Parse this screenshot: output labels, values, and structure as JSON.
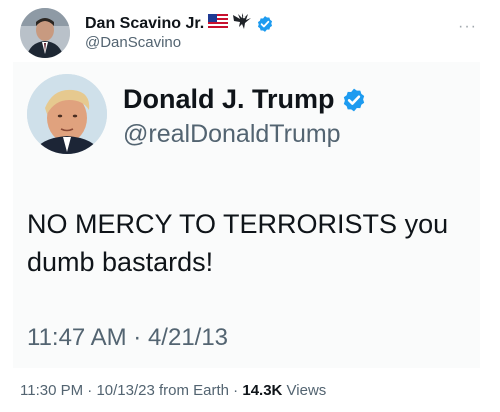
{
  "outer": {
    "name": "Dan Scavino Jr.",
    "name_emojis": [
      "us-flag-icon",
      "eagle-icon"
    ],
    "handle": "@DanScavino",
    "more_label": "···"
  },
  "quoted": {
    "name": "Donald J. Trump",
    "handle": "@realDonaldTrump",
    "text_line1": "NO MERCY TO TERRORISTS you",
    "text_line2": "dumb bastards!",
    "timestamp": "11:47 AM · 4/21/13"
  },
  "footer": {
    "time": "11:30 PM",
    "sep1": " · ",
    "date": "10/13/23",
    "from": " from Earth",
    "sep2": " · ",
    "views_count": "14.3K",
    "views_label": " Views"
  },
  "colors": {
    "verified_blue": "#1d9bf0",
    "secondary_text": "#536471",
    "primary_text": "#0f1419"
  }
}
